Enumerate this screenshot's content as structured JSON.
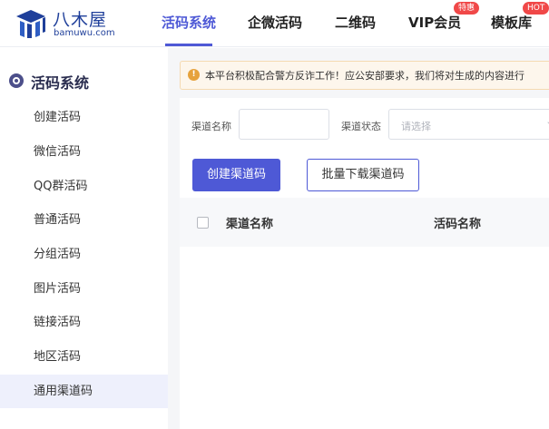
{
  "brand": {
    "name": "八木屋",
    "domain": "bamuwu.com"
  },
  "nav": {
    "items": [
      {
        "label": "活码系统",
        "active": true
      },
      {
        "label": "企微活码"
      },
      {
        "label": "二维码"
      },
      {
        "label": "VIP会员",
        "badge": "特惠"
      },
      {
        "label": "模板库",
        "badge": "HOT"
      }
    ]
  },
  "sidebar": {
    "title": "活码系统",
    "items": [
      {
        "label": "创建活码"
      },
      {
        "label": "微信活码"
      },
      {
        "label": "QQ群活码"
      },
      {
        "label": "普通活码"
      },
      {
        "label": "分组活码"
      },
      {
        "label": "图片活码"
      },
      {
        "label": "链接活码"
      },
      {
        "label": "地区活码"
      },
      {
        "label": "通用渠道码",
        "active": true
      }
    ]
  },
  "notice": {
    "text": "本平台积极配合警方反诈工作！应公安部要求，我们将对生成的内容进行"
  },
  "filters": {
    "channel_name_label": "渠道名称",
    "channel_name_value": "",
    "channel_status_label": "渠道状态",
    "channel_status_placeholder": "请选择"
  },
  "actions": {
    "create_label": "创建渠道码",
    "batch_download_label": "批量下载渠道码"
  },
  "table": {
    "columns": [
      "渠道名称",
      "活码名称"
    ]
  },
  "colors": {
    "accent": "#4e59d6",
    "hot_badge": "#f04848",
    "notice_bg": "#fdf6ec",
    "notice_icon": "#e6a23c"
  }
}
